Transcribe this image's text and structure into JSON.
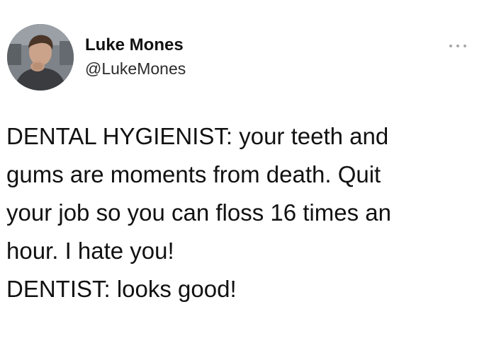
{
  "author": {
    "display_name": "Luke Mones",
    "handle": "@LukeMones",
    "avatar_icon": "profile-photo"
  },
  "menu": {
    "icon": "more-options-icon"
  },
  "tweet": {
    "lines": [
      "DENTAL HYGIENIST: your teeth and",
      "gums are moments from death. Quit",
      "your job so you can floss 16 times an",
      "hour. I hate you!",
      "DENTIST: looks good!"
    ]
  }
}
